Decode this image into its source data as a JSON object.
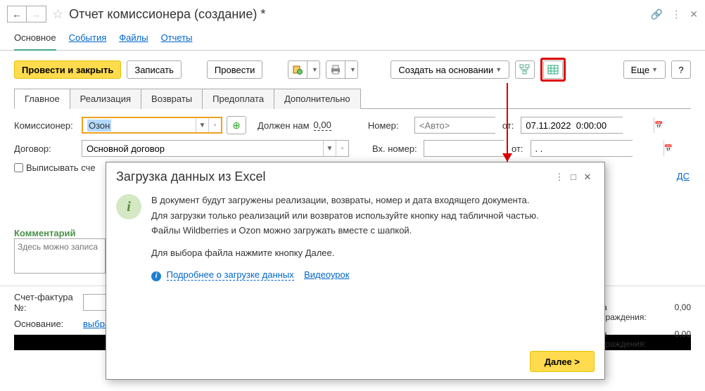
{
  "title": "Отчет комиссионера (создание) *",
  "nav": {
    "main": "Основное",
    "events": "События",
    "files": "Файлы",
    "reports": "Отчеты"
  },
  "toolbar": {
    "post_close": "Провести и закрыть",
    "save": "Записать",
    "post": "Провести",
    "create_based": "Создать на основании",
    "more": "Еще"
  },
  "doc_tabs": {
    "main": "Главное",
    "sales": "Реализация",
    "returns": "Возвраты",
    "prepay": "Предоплата",
    "extra": "Дополнительно"
  },
  "form": {
    "commissioner_label": "Комиссионер:",
    "commissioner_value": "Озон",
    "owes_label": "Должен нам",
    "owes_value": "0,00",
    "number_label": "Номер:",
    "number_placeholder": "<Авто>",
    "from_label": "от:",
    "date_value": "07.11.2022  0:00:00",
    "contract_label": "Договор:",
    "contract_value": "Основной договор",
    "ext_number_label": "Вх. номер:",
    "from2_label": "от:",
    "date2_value": ". .",
    "issue_invoice": "Выписывать сче",
    "nds_link": "ДС",
    "comment_label": "Комментарий",
    "comment_placeholder": "Здесь можно записа",
    "invoice_label": "Счет-фактура №:",
    "basis_label": "Основание:",
    "basis_link": "выбра",
    "reward_label": "а\nграждения:",
    "reward_value": "0,00"
  },
  "modal": {
    "title": "Загрузка данных из Excel",
    "p1": "В документ будут загружены реализации, возвраты, номер и дата входящего документа.",
    "p2": "Для загрузки только реализаций или возвратов используйте кнопку над табличной частью.",
    "p3": "Файлы Wildberries и Ozon можно загружать вместе с шапкой.",
    "p4": "Для выбора файла нажмите кнопку Далее.",
    "link1": "Подробнее о загрузке данных",
    "link2": "Видеоурок",
    "next": "Далее >"
  }
}
